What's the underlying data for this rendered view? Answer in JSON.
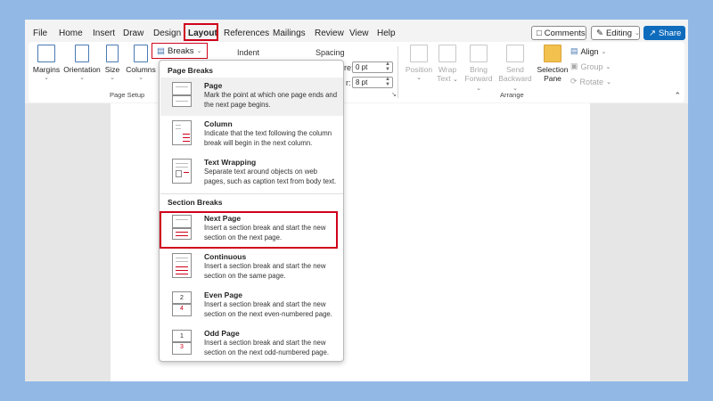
{
  "tabs": [
    "File",
    "Home",
    "Insert",
    "Draw",
    "Design",
    "Layout",
    "References",
    "Mailings",
    "Review",
    "View",
    "Help"
  ],
  "active_tab": "Layout",
  "header_buttons": {
    "comments": "Comments",
    "editing": "Editing",
    "share": "Share"
  },
  "page_setup": {
    "buttons": [
      "Margins",
      "Orientation",
      "Size",
      "Columns"
    ],
    "group_label": "Page Setup",
    "breaks_label": "Breaks"
  },
  "paragraph": {
    "indent_label": "Indent",
    "spacing_label": "Spacing",
    "before_label": "re:",
    "after_label": "r:",
    "before_value": "0 pt",
    "after_value": "8 pt"
  },
  "arrange": {
    "position": "Position",
    "wrap_text": [
      "Wrap",
      "Text"
    ],
    "bring_forward": [
      "Bring",
      "Forward"
    ],
    "send_backward": [
      "Send",
      "Backward"
    ],
    "selection_pane": [
      "Selection",
      "Pane"
    ],
    "align": "Align",
    "group": "Group",
    "rotate": "Rotate",
    "group_label": "Arrange"
  },
  "breaks_menu": {
    "page_breaks_header": "Page Breaks",
    "section_breaks_header": "Section Breaks",
    "items": [
      {
        "title": "Page",
        "desc": "Mark the point at which one page ends and the next page begins."
      },
      {
        "title": "Column",
        "desc": "Indicate that the text following the column break will begin in the next column."
      },
      {
        "title": "Text Wrapping",
        "desc": "Separate text around objects on web pages, such as caption text from body text."
      },
      {
        "title": "Next Page",
        "desc": "Insert a section break and start the new section on the next page."
      },
      {
        "title": "Continuous",
        "desc": "Insert a section break and start the new section on the same page."
      },
      {
        "title": "Even Page",
        "desc": "Insert a section break and start the new section on the next even-numbered page."
      },
      {
        "title": "Odd Page",
        "desc": "Insert a section break and start the new section on the next odd-numbered page."
      }
    ],
    "even_page_thumb_numbers": [
      "2",
      "4"
    ],
    "odd_page_thumb_numbers": [
      "1",
      "3"
    ]
  },
  "colors": {
    "accent_red": "#d0021b",
    "share_blue": "#0f6cbd",
    "background_blue": "#92b8e6"
  }
}
